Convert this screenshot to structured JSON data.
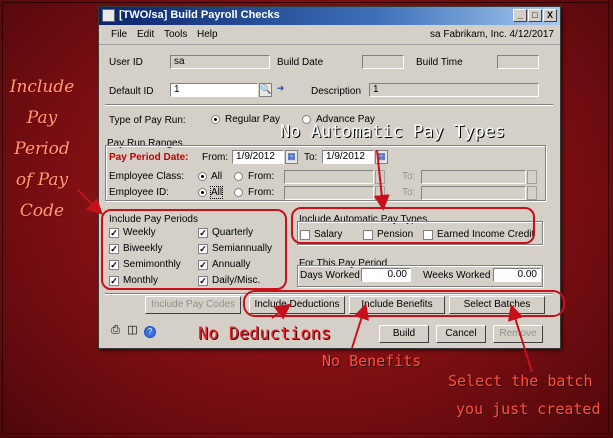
{
  "window": {
    "title": "[TWO/sa] Build Payroll Checks",
    "minimize": "_",
    "maximize": "□",
    "close": "X"
  },
  "menu": [
    "File",
    "Edit",
    "Tools",
    "Help"
  ],
  "company": "sa  Fabrikam, Inc.  4/12/2017",
  "header": {
    "user_id_label": "User ID",
    "user_id": "sa",
    "build_date_label": "Build Date",
    "build_time_label": "Build Time",
    "default_id_label": "Default ID",
    "default_id": "1",
    "description_label": "Description",
    "description": "1"
  },
  "pay_run": {
    "type_label": "Type of Pay Run:",
    "regular": "Regular Pay",
    "advance": "Advance Pay"
  },
  "ranges": {
    "group_label": "Pay Run Ranges",
    "period_date_label": "Pay Period Date:",
    "from_label": "From:",
    "from_date": "1/9/2012",
    "to_label": "To:",
    "to_date": "1/9/2012",
    "class_label": "Employee Class:",
    "id_label": "Employee ID:",
    "all": "All",
    "from": "From:",
    "to": "To:"
  },
  "pay_periods": {
    "label": "Include Pay Periods",
    "items": [
      "Weekly",
      "Biweekly",
      "Semimonthly",
      "Monthly",
      "Quarterly",
      "Semiannually",
      "Annually",
      "Daily/Misc."
    ],
    "check": "✓"
  },
  "auto_pay": {
    "label": "Include Automatic Pay Types",
    "items": [
      "Salary",
      "Pension",
      "Earned Income Credit"
    ]
  },
  "this_period": {
    "label": "For This Pay Period",
    "days_label": "Days Worked",
    "days": "0.00",
    "weeks_label": "Weeks Worked",
    "weeks": "0.00"
  },
  "buttons": {
    "pay_codes": "Include Pay Codes",
    "deductions": "Include Deductions",
    "benefits": "Include Benefits",
    "batches": "Select Batches",
    "build": "Build",
    "cancel": "Cancel",
    "remove": "Remove"
  },
  "annotations": {
    "side": [
      "Include",
      "Pay",
      "Period",
      "of Pay",
      "Code"
    ],
    "no_auto": "No Automatic Pay Types",
    "no_deductions": "No Deductions",
    "no_benefits": "No Benefits",
    "select_batch_1": "Select the batch",
    "select_batch_2": "you just created"
  }
}
